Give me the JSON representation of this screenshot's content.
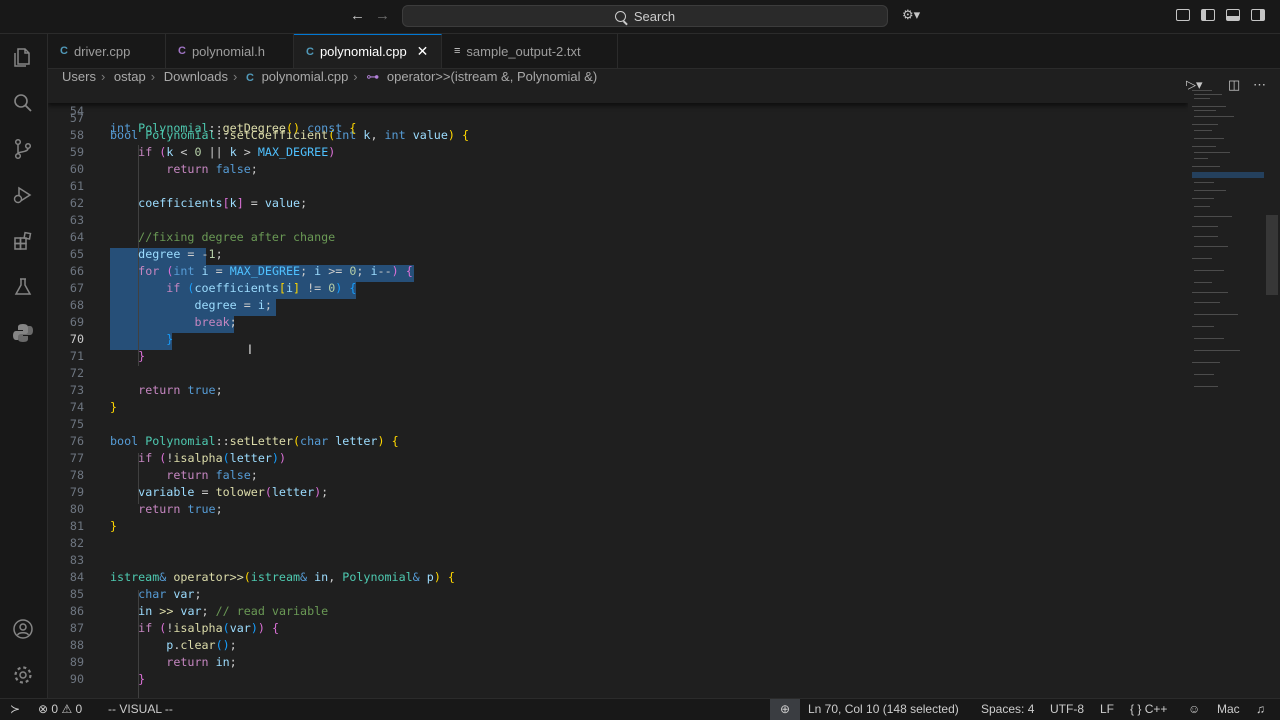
{
  "titlebar": {
    "search_label": "Search"
  },
  "tabs": [
    {
      "icon": "C",
      "label": "driver.cpp"
    },
    {
      "icon": "C",
      "label": "polynomial.h"
    },
    {
      "icon": "C",
      "label": "polynomial.cpp",
      "active": true
    },
    {
      "icon": "≡",
      "label": "sample_output-2.txt"
    }
  ],
  "breadcrumb": [
    "Users",
    "ostap",
    "Downloads",
    "polynomial.cpp",
    "operator>>(istream &, Polynomial &)"
  ],
  "sticky_line": {
    "number": "54"
  },
  "line_numbers": [
    "57",
    "58",
    "59",
    "60",
    "61",
    "62",
    "63",
    "64",
    "65",
    "66",
    "67",
    "68",
    "69",
    "70",
    "71",
    "72",
    "73",
    "74",
    "75",
    "76",
    "77",
    "78",
    "79",
    "80",
    "81",
    "82",
    "83",
    "84",
    "85",
    "86",
    "87",
    "88",
    "89",
    "90"
  ],
  "current_line": "70",
  "status": {
    "errors": "0",
    "warnings": "0",
    "mode": "-- VISUAL --",
    "position": "Ln 70, Col 10 (148 selected)",
    "spaces": "Spaces: 4",
    "encoding": "UTF-8",
    "eol": "LF",
    "language": "C++",
    "keymap": "Mac"
  }
}
